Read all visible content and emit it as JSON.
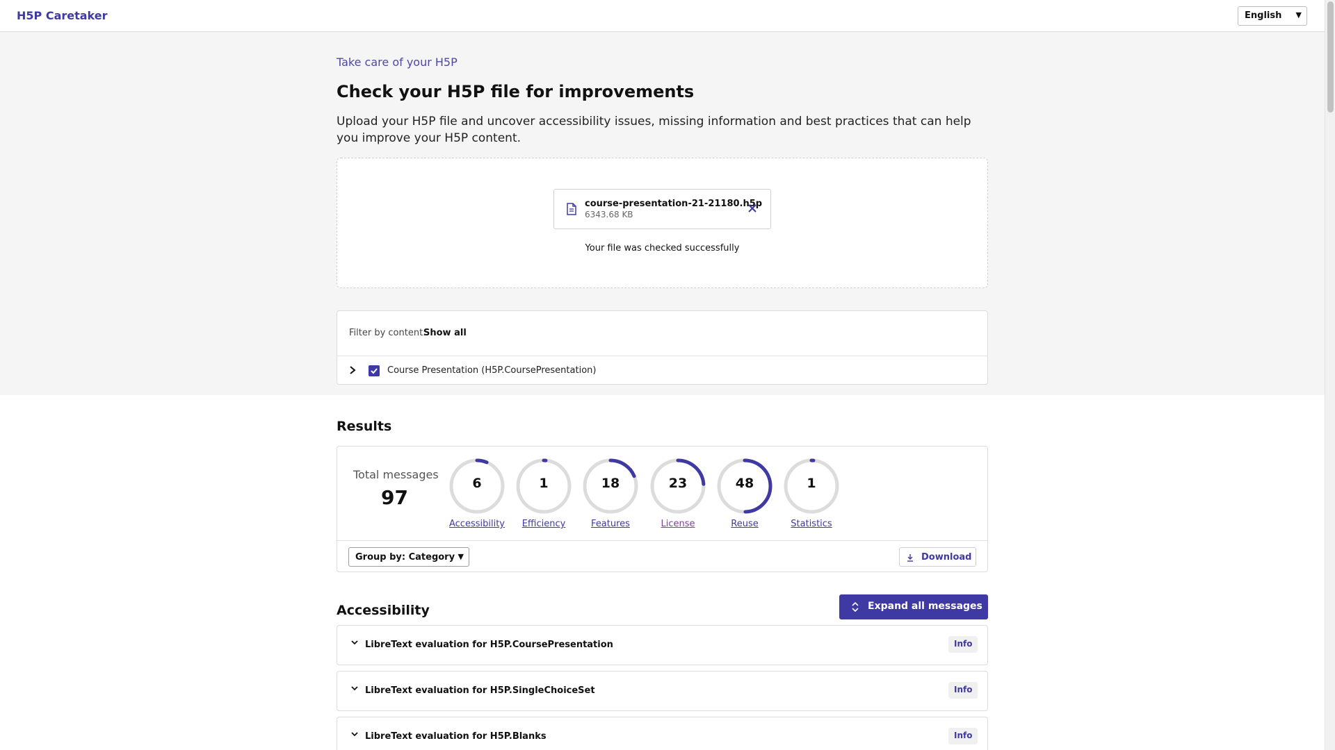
{
  "header": {
    "brand": "H5P Caretaker",
    "language": "English"
  },
  "intro": {
    "eyebrow": "Take care of your H5P",
    "title": "Check your H5P file for improvements",
    "description": "Upload your H5P file and uncover accessibility issues, missing information and best practices that can help you improve your H5P content."
  },
  "upload": {
    "file_name": "course-presentation-21-21180.h5p",
    "file_size": "6343.68 KB",
    "status": "Your file was checked successfully"
  },
  "filter": {
    "label": "Filter by content:",
    "value": "Show all",
    "items": [
      {
        "label": "Course Presentation (H5P.CoursePresentation)",
        "checked": true
      }
    ]
  },
  "results": {
    "title": "Results",
    "total_label": "Total messages",
    "total_value": "97",
    "categories": [
      {
        "label": "Accessibility",
        "count": "6",
        "fraction": 0.062,
        "visited": false
      },
      {
        "label": "Efficiency",
        "count": "1",
        "fraction": 0.01,
        "visited": false
      },
      {
        "label": "Features",
        "count": "18",
        "fraction": 0.186,
        "visited": false
      },
      {
        "label": "License",
        "count": "23",
        "fraction": 0.237,
        "visited": true
      },
      {
        "label": "Reuse",
        "count": "48",
        "fraction": 0.495,
        "visited": false
      },
      {
        "label": "Statistics",
        "count": "1",
        "fraction": 0.01,
        "visited": false
      }
    ],
    "group_by": "Group by: Category",
    "download": "Download"
  },
  "accessibility": {
    "title": "Accessibility",
    "expand_label": "Expand all messages",
    "messages": [
      {
        "text": "LibreText evaluation for H5P.CoursePresentation",
        "badge": "Info"
      },
      {
        "text": "LibreText evaluation for H5P.SingleChoiceSet",
        "badge": "Info"
      },
      {
        "text": "LibreText evaluation for H5P.Blanks",
        "badge": "Info"
      }
    ]
  },
  "colors": {
    "accent": "#3f3aa3",
    "ring_track": "#dcdcdc",
    "visited_link": "#7b3f9e"
  }
}
